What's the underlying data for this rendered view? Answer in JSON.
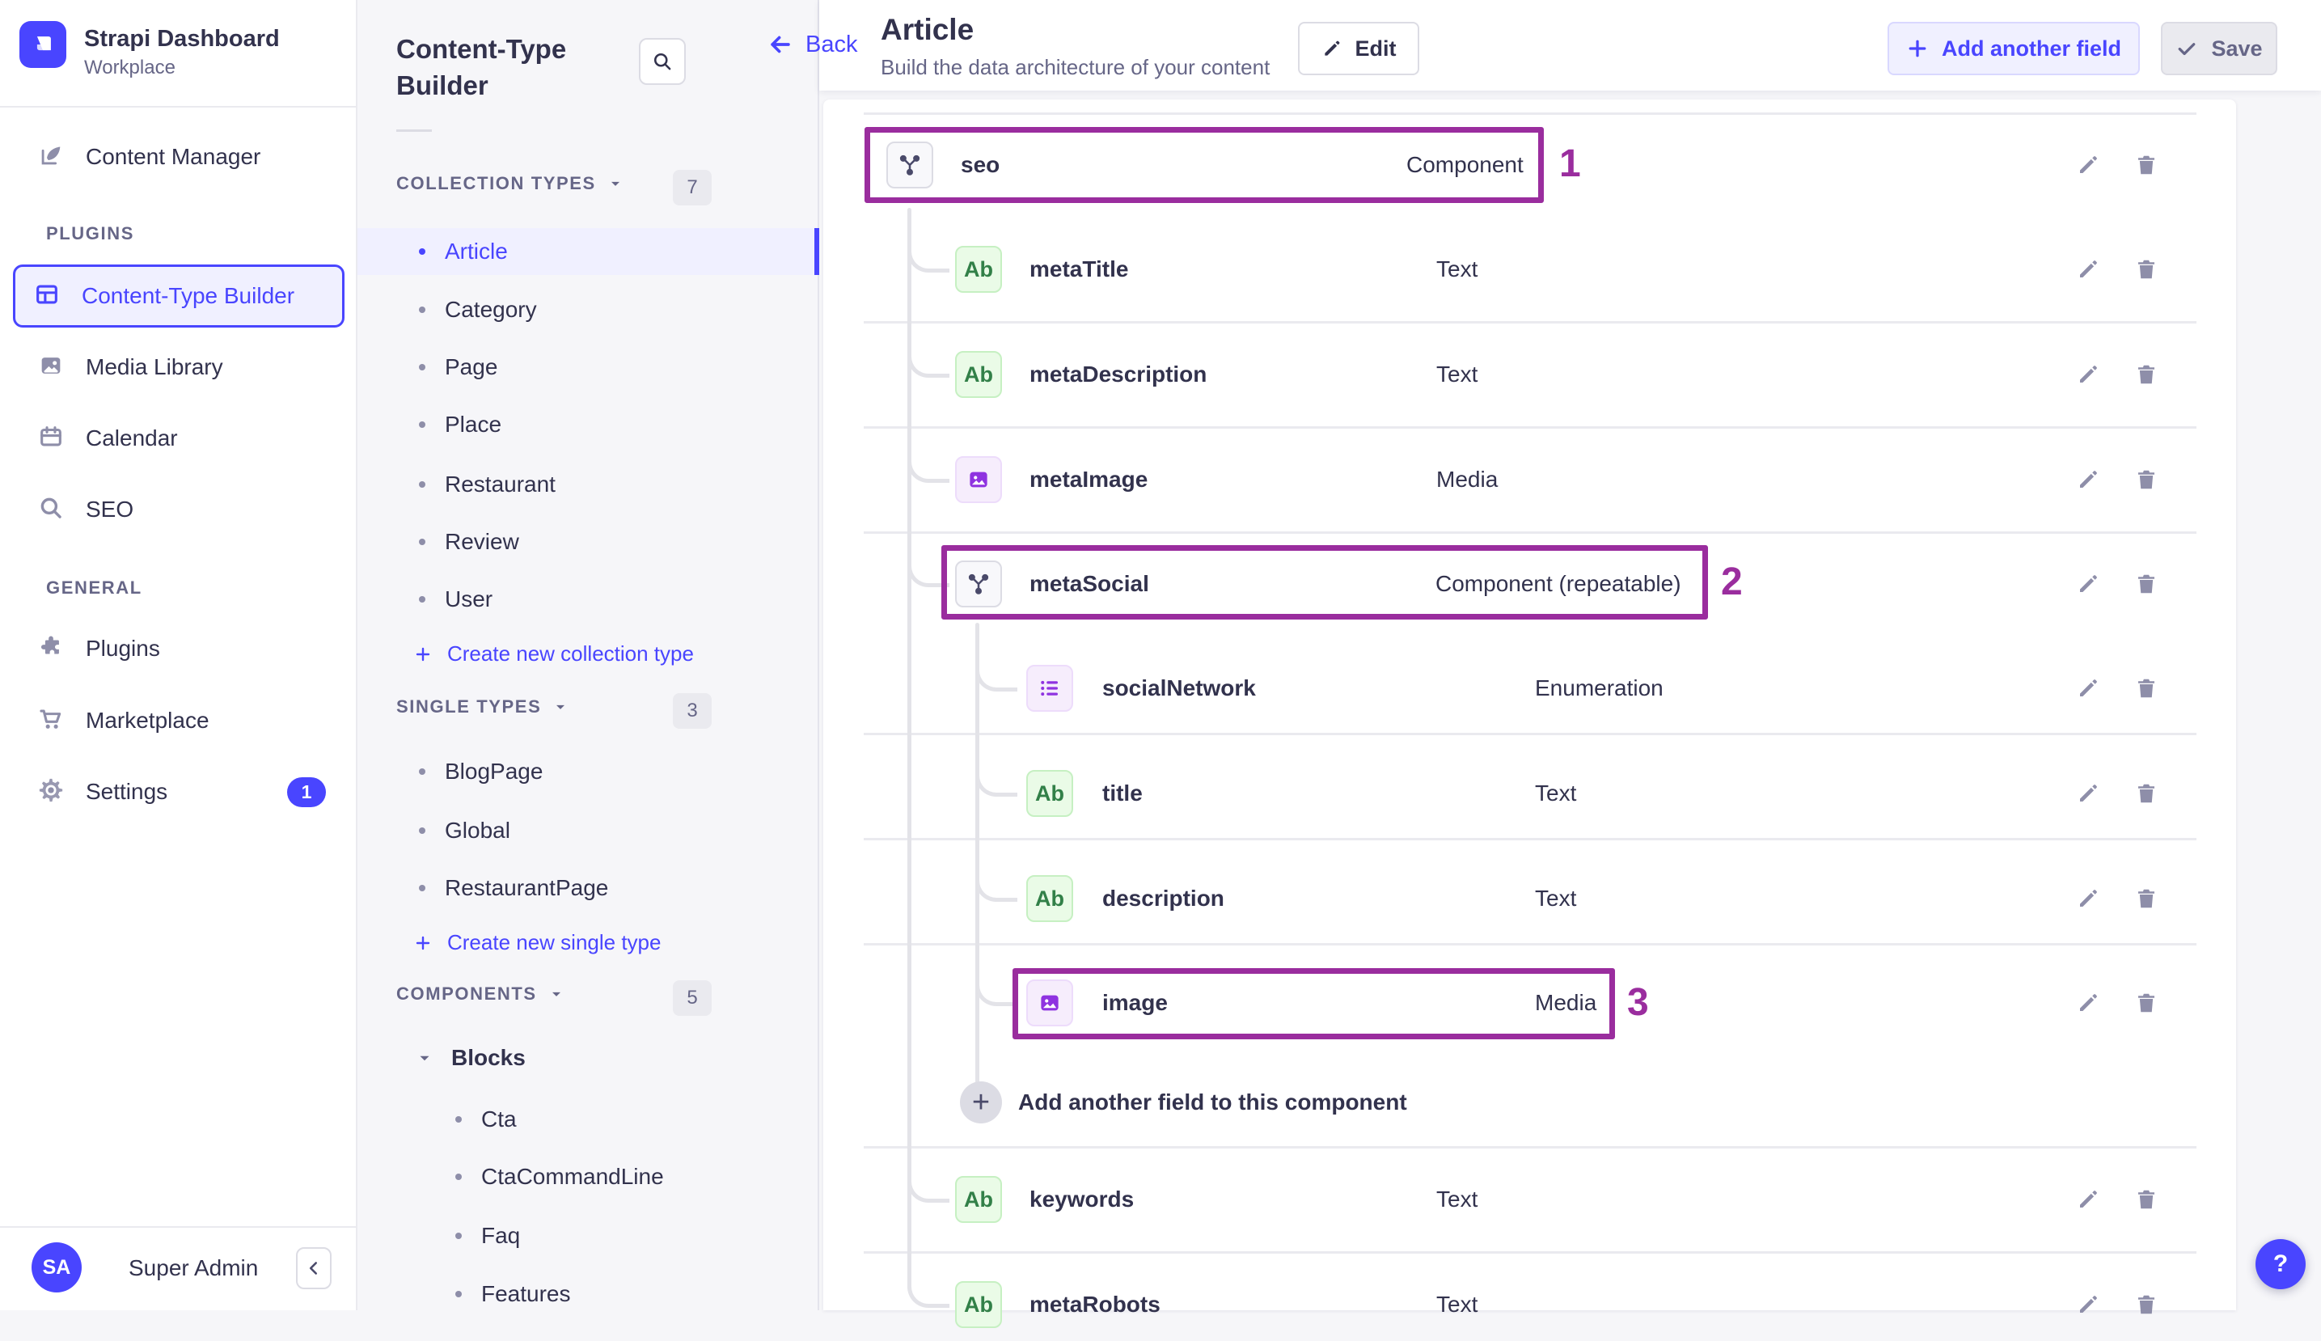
{
  "left_nav": {
    "brand_title": "Strapi Dashboard",
    "brand_subtitle": "Workplace",
    "content_manager": "Content Manager",
    "sections": [
      {
        "label": "PLUGINS",
        "items": [
          {
            "label": "Content-Type Builder"
          },
          {
            "label": "Media Library"
          },
          {
            "label": "Calendar"
          },
          {
            "label": "SEO"
          }
        ]
      },
      {
        "label": "GENERAL",
        "items": [
          {
            "label": "Plugins"
          },
          {
            "label": "Marketplace"
          },
          {
            "label": "Settings",
            "badge": "1"
          }
        ]
      }
    ],
    "user": {
      "initials": "SA",
      "name": "Super Admin"
    }
  },
  "type_nav": {
    "title": "Content-Type Builder",
    "groups": [
      {
        "label": "COLLECTION TYPES",
        "count": "7",
        "items": [
          "Article",
          "Category",
          "Page",
          "Place",
          "Restaurant",
          "Review",
          "User"
        ],
        "action": "Create new collection type"
      },
      {
        "label": "SINGLE TYPES",
        "count": "3",
        "items": [
          "BlogPage",
          "Global",
          "RestaurantPage"
        ],
        "action": "Create new single type"
      },
      {
        "label": "COMPONENTS",
        "count": "5",
        "category": "Blocks",
        "items": [
          "Cta",
          "CtaCommandLine",
          "Faq",
          "Features"
        ]
      }
    ]
  },
  "header": {
    "back": "Back",
    "title": "Article",
    "subtitle": "Build the data architecture of your content",
    "edit": "Edit",
    "add_field": "Add another field",
    "save": "Save"
  },
  "fields": [
    {
      "name": "seo",
      "type": "Component",
      "highlight": "1"
    },
    {
      "name": "metaTitle",
      "type": "Text"
    },
    {
      "name": "metaDescription",
      "type": "Text"
    },
    {
      "name": "metaImage",
      "type": "Media"
    },
    {
      "name": "metaSocial",
      "type": "Component (repeatable)",
      "highlight": "2"
    },
    {
      "name": "socialNetwork",
      "type": "Enumeration"
    },
    {
      "name": "title",
      "type": "Text"
    },
    {
      "name": "description",
      "type": "Text"
    },
    {
      "name": "image",
      "type": "Media",
      "highlight": "3"
    },
    {
      "name": "keywords",
      "type": "Text"
    },
    {
      "name": "metaRobots",
      "type": "Text"
    }
  ],
  "add_component_field": "Add another field to this component",
  "help": {
    "label": "?"
  }
}
